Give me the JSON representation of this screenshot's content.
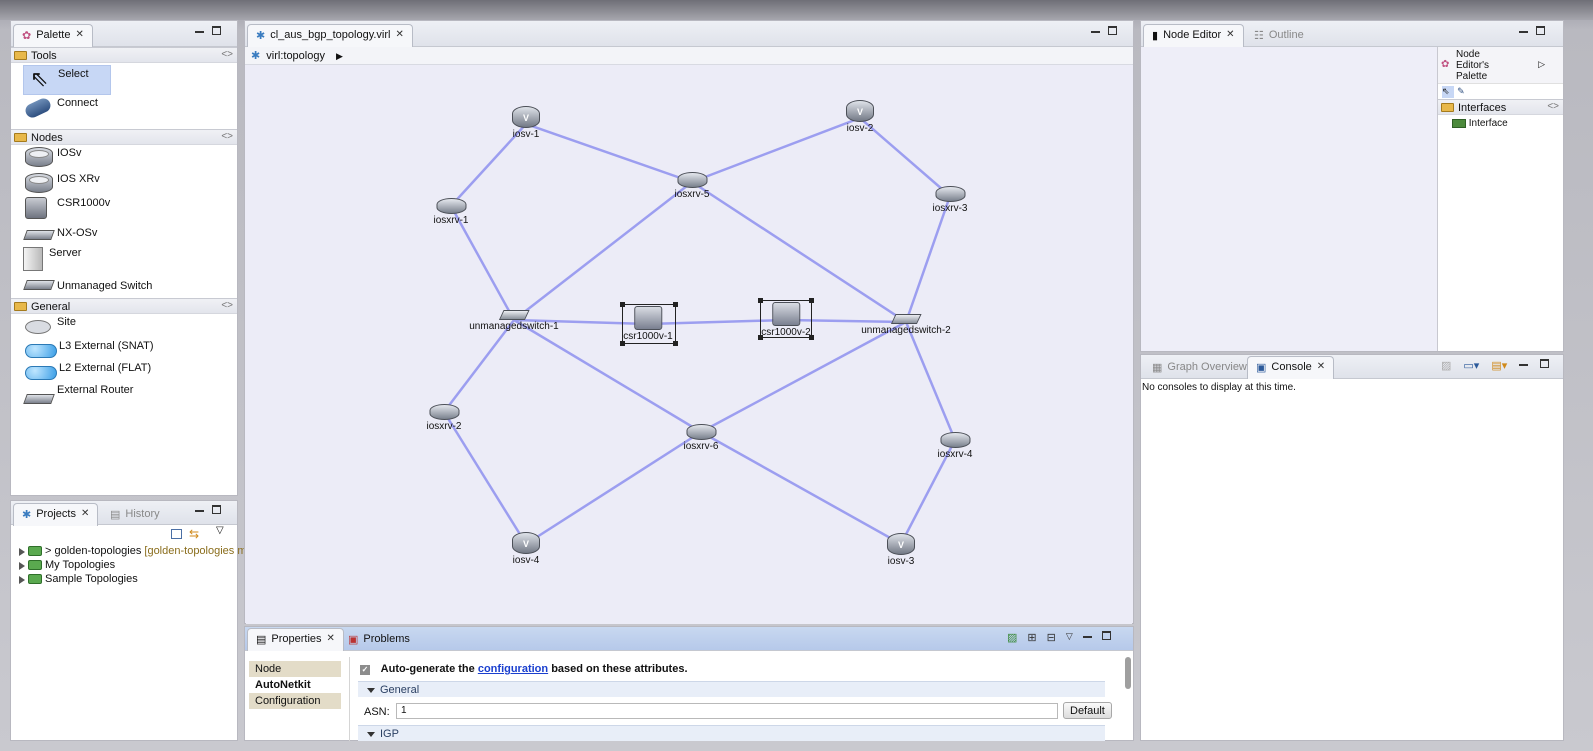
{
  "palette": {
    "tab_label": "Palette",
    "tools": {
      "header": "Tools",
      "items": [
        "Select",
        "Connect"
      ]
    },
    "nodes": {
      "header": "Nodes",
      "items": [
        "IOSv",
        "IOS XRv",
        "CSR1000v",
        "NX-OSv",
        "Server",
        "Unmanaged Switch"
      ]
    },
    "general": {
      "header": "General",
      "items": [
        "Site",
        "L3 External (SNAT)",
        "L2 External (FLAT)",
        "External Router"
      ]
    }
  },
  "editor": {
    "tab_label": "cl_aus_bgp_topology.virl",
    "breadcrumb": "virl:topology"
  },
  "topology": {
    "nodes": {
      "iosv1": "iosv-1",
      "iosv2": "iosv-2",
      "iosv3": "iosv-3",
      "iosv4": "iosv-4",
      "iosxrv1": "iosxrv-1",
      "iosxrv2": "iosxrv-2",
      "iosxrv3": "iosxrv-3",
      "iosxrv4": "iosxrv-4",
      "iosxrv5": "iosxrv-5",
      "iosxrv6": "iosxrv-6",
      "sw1": "unmanagedswitch-1",
      "sw2": "unmanagedswitch-2",
      "csr1": "csr1000v-1",
      "csr2": "csr1000v-2"
    },
    "link_color": "#9c9ef0"
  },
  "projects": {
    "tab_projects": "Projects",
    "tab_history": "History",
    "tree": [
      {
        "label": "> golden-topologies",
        "suffix": "[golden-topologies m"
      },
      {
        "label": "My Topologies",
        "suffix": ""
      },
      {
        "label": "Sample Topologies",
        "suffix": ""
      }
    ]
  },
  "properties": {
    "tab_properties": "Properties",
    "tab_problems": "Problems",
    "side_tabs": [
      "Node",
      "AutoNetkit",
      "Configuration"
    ],
    "auto_text_before": "Auto-generate the",
    "auto_link": "configuration",
    "auto_text_after": "based on these attributes.",
    "section_general": "General",
    "asn_label": "ASN:",
    "asn_value": "1",
    "default_button": "Default",
    "section_igp": "IGP"
  },
  "node_editor": {
    "tab_label": "Node Editor",
    "tab_outline": "Outline",
    "palette_title": "Node Editor's Palette",
    "interfaces_header": "Interfaces",
    "interface_item": "Interface"
  },
  "console": {
    "tab_graph": "Graph Overview",
    "tab_console": "Console",
    "message": "No consoles to display at this time."
  }
}
